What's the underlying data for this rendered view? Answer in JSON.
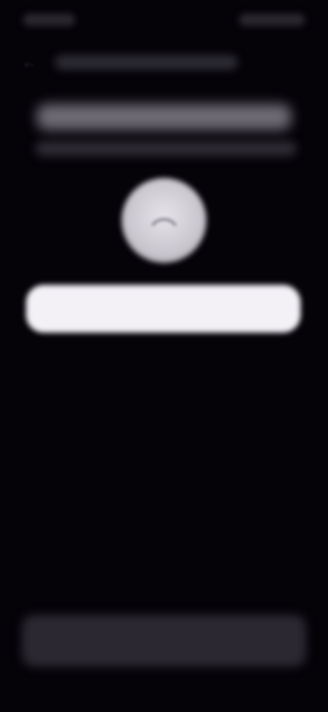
{
  "status_bar": {
    "time": "",
    "icons": [
      "signal-icon",
      "wifi-icon",
      "battery-icon"
    ]
  },
  "app_bar": {
    "title": "",
    "back_icon": "back-arrow-icon"
  },
  "main": {
    "heading": "",
    "subheading": "",
    "avatar_icon": "avatar-placeholder-icon",
    "primary_button_label": ""
  },
  "footer": {
    "button_label": ""
  },
  "colors": {
    "background": "#050208",
    "primary_button": "#f3f1f6",
    "secondary_button": "#2b2831",
    "avatar": "#d9d6de"
  }
}
